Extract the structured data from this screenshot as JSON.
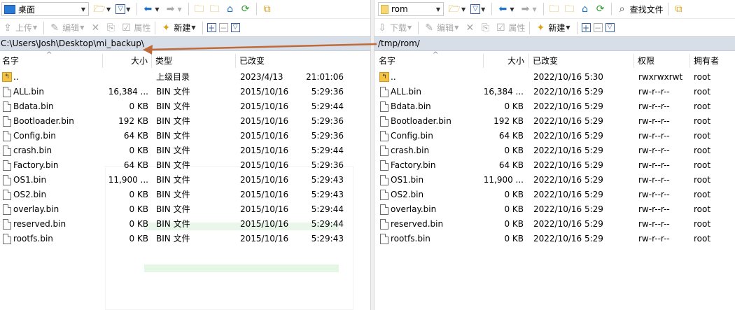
{
  "left": {
    "location": "桌面",
    "toolbar2": {
      "upload": "上传",
      "edit": "编辑",
      "properties": "属性",
      "new": "新建"
    },
    "path": "C:\\Users\\Josh\\Desktop\\mi_backup\\",
    "headers": {
      "name": "名字",
      "size": "大小",
      "type": "类型",
      "modified": "已改变"
    },
    "rows": [
      {
        "name": "..",
        "size": "",
        "type": "上级目录",
        "date": "2023/4/13",
        "time": "21:01:06",
        "up": true
      },
      {
        "name": "ALL.bin",
        "size": "16,384 ...",
        "type": "BIN 文件",
        "date": "2015/10/16",
        "time": "5:29:36"
      },
      {
        "name": "Bdata.bin",
        "size": "0 KB",
        "type": "BIN 文件",
        "date": "2015/10/16",
        "time": "5:29:44"
      },
      {
        "name": "Bootloader.bin",
        "size": "192 KB",
        "type": "BIN 文件",
        "date": "2015/10/16",
        "time": "5:29:36"
      },
      {
        "name": "Config.bin",
        "size": "64 KB",
        "type": "BIN 文件",
        "date": "2015/10/16",
        "time": "5:29:36"
      },
      {
        "name": "crash.bin",
        "size": "0 KB",
        "type": "BIN 文件",
        "date": "2015/10/16",
        "time": "5:29:44"
      },
      {
        "name": "Factory.bin",
        "size": "64 KB",
        "type": "BIN 文件",
        "date": "2015/10/16",
        "time": "5:29:36"
      },
      {
        "name": "OS1.bin",
        "size": "11,900 ...",
        "type": "BIN 文件",
        "date": "2015/10/16",
        "time": "5:29:43"
      },
      {
        "name": "OS2.bin",
        "size": "0 KB",
        "type": "BIN 文件",
        "date": "2015/10/16",
        "time": "5:29:43"
      },
      {
        "name": "overlay.bin",
        "size": "0 KB",
        "type": "BIN 文件",
        "date": "2015/10/16",
        "time": "5:29:44"
      },
      {
        "name": "reserved.bin",
        "size": "0 KB",
        "type": "BIN 文件",
        "date": "2015/10/16",
        "time": "5:29:44"
      },
      {
        "name": "rootfs.bin",
        "size": "0 KB",
        "type": "BIN 文件",
        "date": "2015/10/16",
        "time": "5:29:43"
      }
    ]
  },
  "right": {
    "location": "rom",
    "find_files": "查找文件",
    "toolbar2": {
      "download": "下载",
      "edit": "编辑",
      "properties": "属性",
      "new": "新建"
    },
    "path": "/tmp/rom/",
    "headers": {
      "name": "名字",
      "size": "大小",
      "modified": "已改变",
      "permissions": "权限",
      "owner": "拥有者"
    },
    "rows": [
      {
        "name": "..",
        "size": "",
        "modified": "2022/10/16 5:30",
        "perm": "rwxrwxrwt",
        "owner": "root",
        "up": true
      },
      {
        "name": "ALL.bin",
        "size": "16,384 ...",
        "modified": "2022/10/16 5:29",
        "perm": "rw-r--r--",
        "owner": "root"
      },
      {
        "name": "Bdata.bin",
        "size": "0 KB",
        "modified": "2022/10/16 5:29",
        "perm": "rw-r--r--",
        "owner": "root"
      },
      {
        "name": "Bootloader.bin",
        "size": "192 KB",
        "modified": "2022/10/16 5:29",
        "perm": "rw-r--r--",
        "owner": "root"
      },
      {
        "name": "Config.bin",
        "size": "64 KB",
        "modified": "2022/10/16 5:29",
        "perm": "rw-r--r--",
        "owner": "root"
      },
      {
        "name": "crash.bin",
        "size": "0 KB",
        "modified": "2022/10/16 5:29",
        "perm": "rw-r--r--",
        "owner": "root"
      },
      {
        "name": "Factory.bin",
        "size": "64 KB",
        "modified": "2022/10/16 5:29",
        "perm": "rw-r--r--",
        "owner": "root"
      },
      {
        "name": "OS1.bin",
        "size": "11,900 ...",
        "modified": "2022/10/16 5:29",
        "perm": "rw-r--r--",
        "owner": "root"
      },
      {
        "name": "OS2.bin",
        "size": "0 KB",
        "modified": "2022/10/16 5:29",
        "perm": "rw-r--r--",
        "owner": "root"
      },
      {
        "name": "overlay.bin",
        "size": "0 KB",
        "modified": "2022/10/16 5:29",
        "perm": "rw-r--r--",
        "owner": "root"
      },
      {
        "name": "reserved.bin",
        "size": "0 KB",
        "modified": "2022/10/16 5:29",
        "perm": "rw-r--r--",
        "owner": "root"
      },
      {
        "name": "rootfs.bin",
        "size": "0 KB",
        "modified": "2022/10/16 5:29",
        "perm": "rw-r--r--",
        "owner": "root"
      }
    ]
  },
  "colors": {
    "pathbar": "#d7dee8",
    "arrow": "#c06a3a",
    "folder": "#f5c342",
    "nav_blue": "#1e73c8",
    "refresh_green": "#2e9a2e"
  },
  "icons": [
    "desktop-icon",
    "folder-icon",
    "open-folder-icon",
    "filter-icon",
    "back-arrow-icon",
    "forward-arrow-icon",
    "parent-folder-icon",
    "root-folder-icon",
    "home-icon",
    "refresh-icon",
    "find-icon",
    "upload-icon",
    "download-icon",
    "edit-icon",
    "delete-icon",
    "rename-icon",
    "properties-icon",
    "new-icon",
    "plus-icon",
    "minus-icon",
    "select-icon"
  ]
}
